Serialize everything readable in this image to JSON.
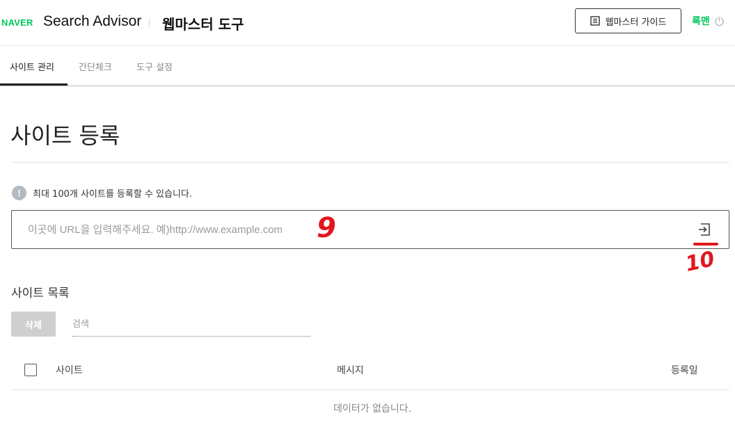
{
  "header": {
    "logo": "NAVER",
    "brand": "Search Advisor",
    "tool_title": "웹마스터 도구",
    "guide_label": "웹마스터 가이드",
    "logout_label": "록맨"
  },
  "tabs": [
    {
      "label": "사이트 관리",
      "active": true
    },
    {
      "label": "간단체크",
      "active": false
    },
    {
      "label": "도구 설정",
      "active": false
    }
  ],
  "page": {
    "title": "사이트 등록",
    "notice": "최대 100개 사이트를 등록할 수 있습니다.",
    "url_placeholder": "이곳에 URL을 입력해주세요. 예)http://www.example.com"
  },
  "annotations": {
    "label_input": "9",
    "label_submit": "10",
    "color": "#e3161e"
  },
  "site_list": {
    "title": "사이트 목록",
    "delete_label": "삭제",
    "search_placeholder": "검색",
    "columns": {
      "site": "사이트",
      "message": "메시지",
      "date": "등록일"
    },
    "empty": "데이터가 없습니다."
  },
  "colors": {
    "brand_green": "#03c75a",
    "disabled_button": "#cfcfcf"
  }
}
